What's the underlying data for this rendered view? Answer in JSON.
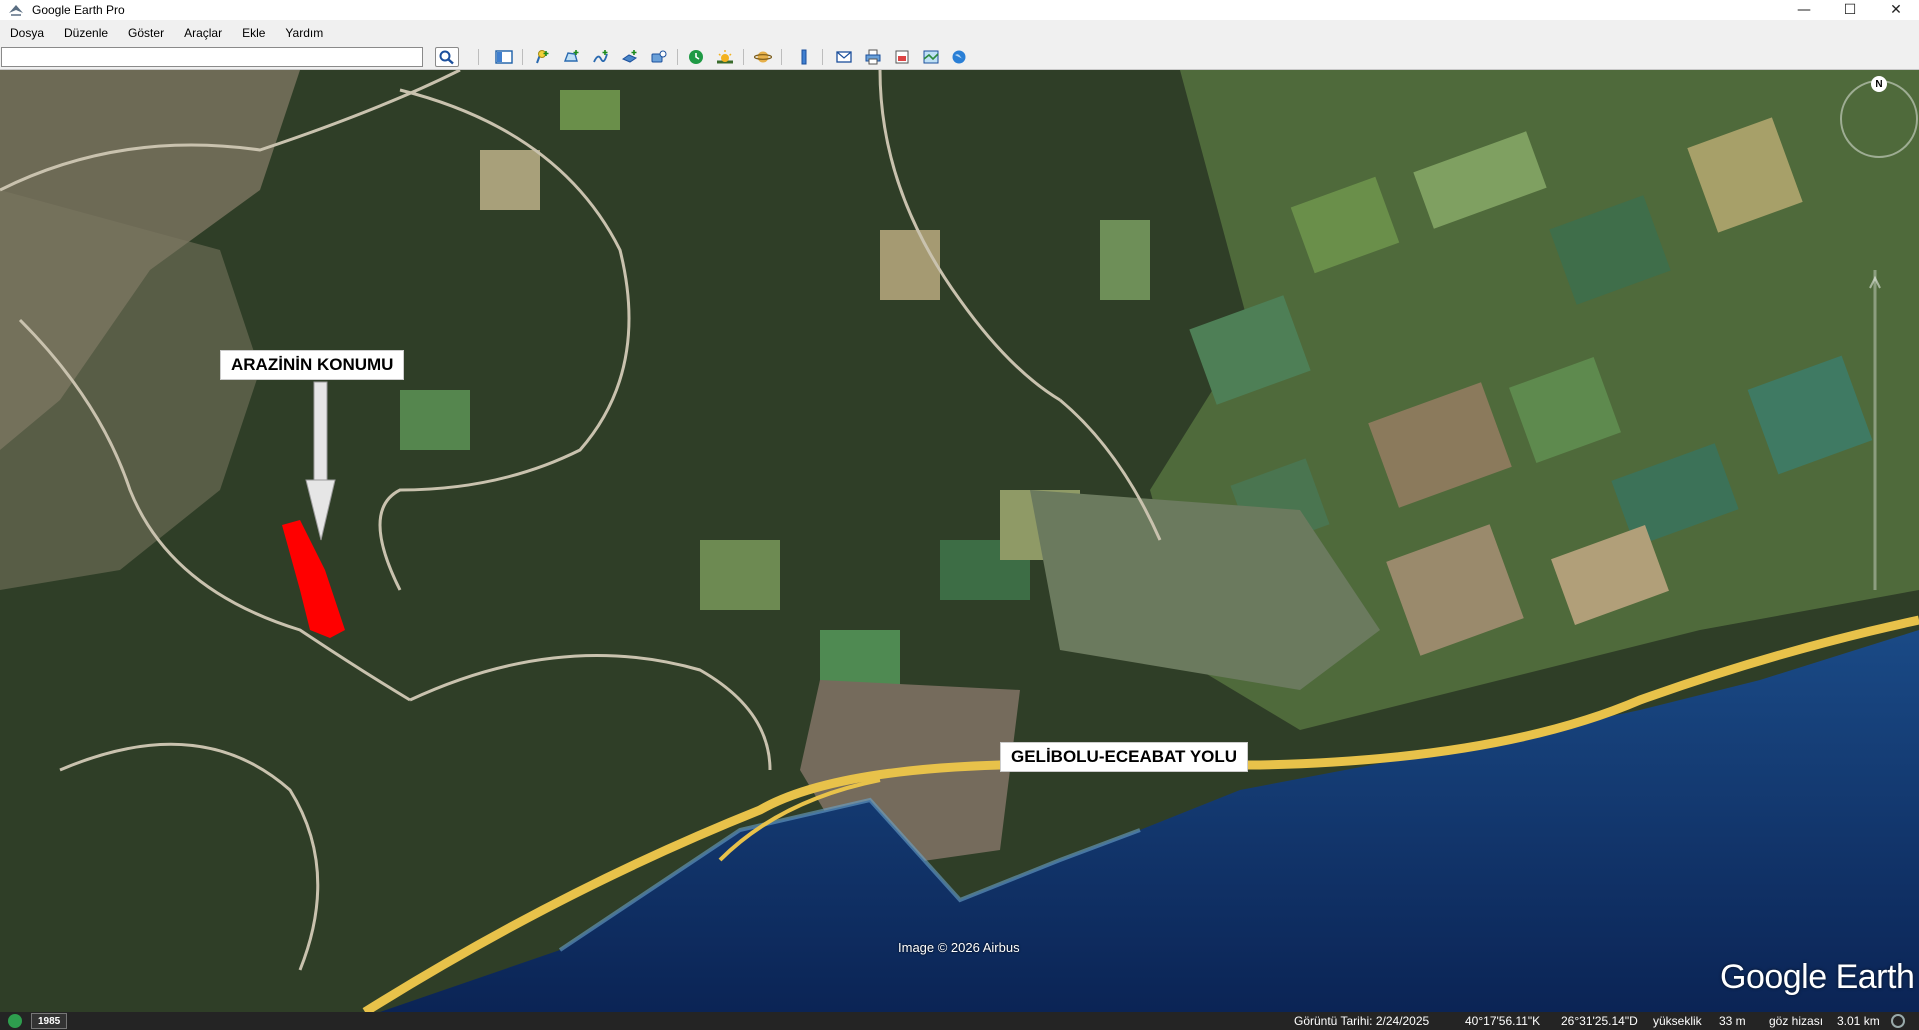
{
  "window": {
    "title": "Google Earth Pro"
  },
  "menu": {
    "items": [
      {
        "label": "Dosya"
      },
      {
        "label": "Düzenle"
      },
      {
        "label": "Göster"
      },
      {
        "label": "Araçlar"
      },
      {
        "label": "Ekle"
      },
      {
        "label": "Yardım"
      }
    ]
  },
  "search": {
    "value": "",
    "placeholder": ""
  },
  "toolbar_icons": [
    "search-icon",
    "sidebar-toggle-icon",
    "add-placemark-icon",
    "add-polygon-icon",
    "add-path-icon",
    "add-image-overlay-icon",
    "record-tour-icon",
    "historical-imagery-icon",
    "sunlight-icon",
    "switch-to-sky-icon",
    "ruler-icon",
    "email-icon",
    "print-icon",
    "save-image-icon",
    "view-in-maps-icon",
    "earth-icon"
  ],
  "map": {
    "annotations": {
      "parcel_label": "ARAZİNİN KONUMU",
      "road_label": "GELİBOLU-ECEABAT YOLU"
    },
    "imagery_credit": "Image © 2026 Airbus",
    "logo": "Google Earth",
    "compass_north": "N",
    "colors": {
      "parcel": "#ff0000",
      "road": "#e8c24a",
      "sea": "#0d2b5c"
    }
  },
  "status": {
    "historical_year": "1985",
    "imagery_date": "Görüntü Tarihi: 2/24/2025",
    "latitude": "40°17'56.11\"K",
    "longitude": "26°31'25.14\"D",
    "elevation_label": "yükseklik",
    "elevation_value": "33 m",
    "eye_alt_label": "göz hizası",
    "eye_alt_value": "3.01 km"
  }
}
